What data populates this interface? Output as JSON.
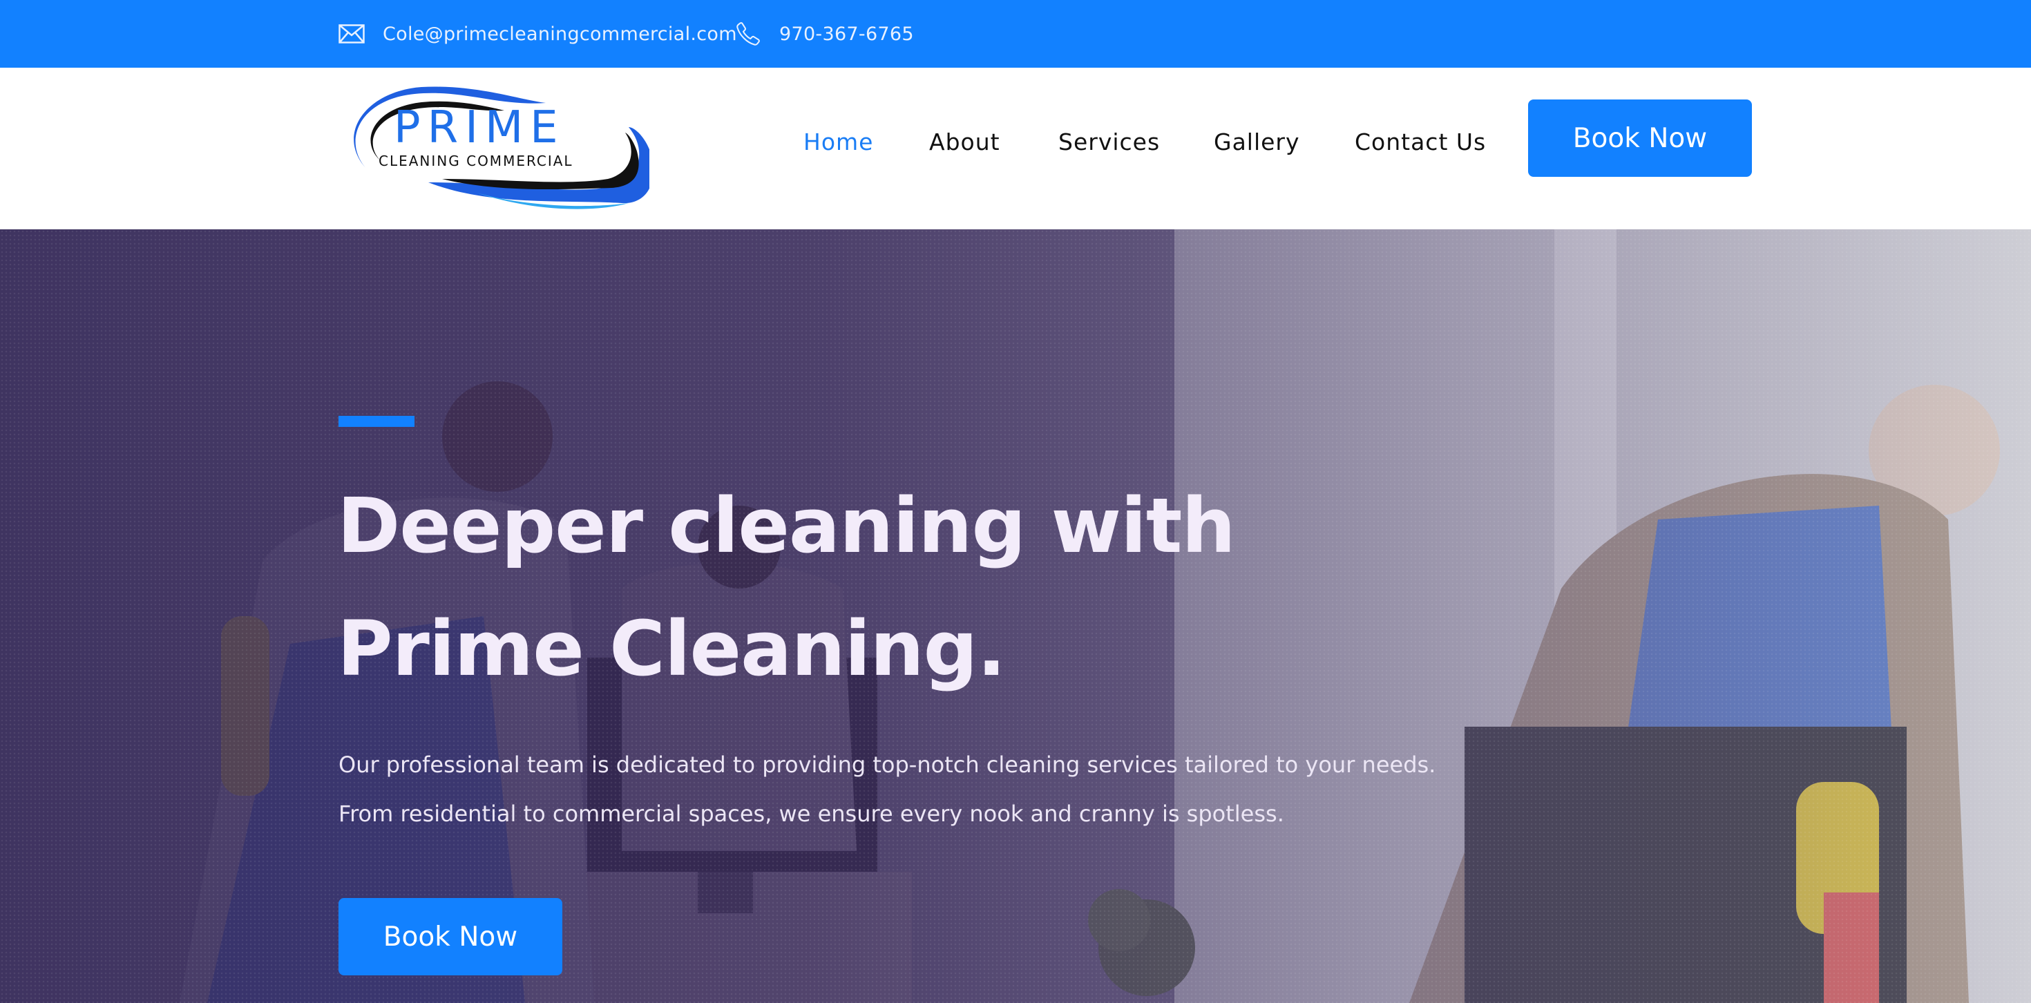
{
  "topbar": {
    "email": "Cole@primecleaningcommercial.com",
    "phone": "970-367-6765",
    "email_icon": "envelope-icon",
    "phone_icon": "phone-icon",
    "background": "#1281ff"
  },
  "logo": {
    "brand": "PRIME",
    "tagline": "CLEANING COMMERCIAL"
  },
  "nav": {
    "items": [
      {
        "label": "Home",
        "active": true
      },
      {
        "label": "About",
        "active": false
      },
      {
        "label": "Services",
        "active": false
      },
      {
        "label": "Gallery",
        "active": false
      },
      {
        "label": "Contact Us",
        "active": false
      }
    ],
    "cta_label": "Book Now"
  },
  "hero": {
    "title_line1": "Deeper cleaning with",
    "title_line2": "Prime Cleaning.",
    "text_line1": "Our professional team is dedicated to providing top-notch cleaning services tailored to your needs.",
    "text_line2": "From residential to commercial spaces, we ensure every nook and cranny is spotless.",
    "cta_label": "Book Now"
  },
  "colors": {
    "accent": "#1281ff",
    "nav_active": "#1a7df5",
    "hero_text": "#f3ecfa"
  }
}
